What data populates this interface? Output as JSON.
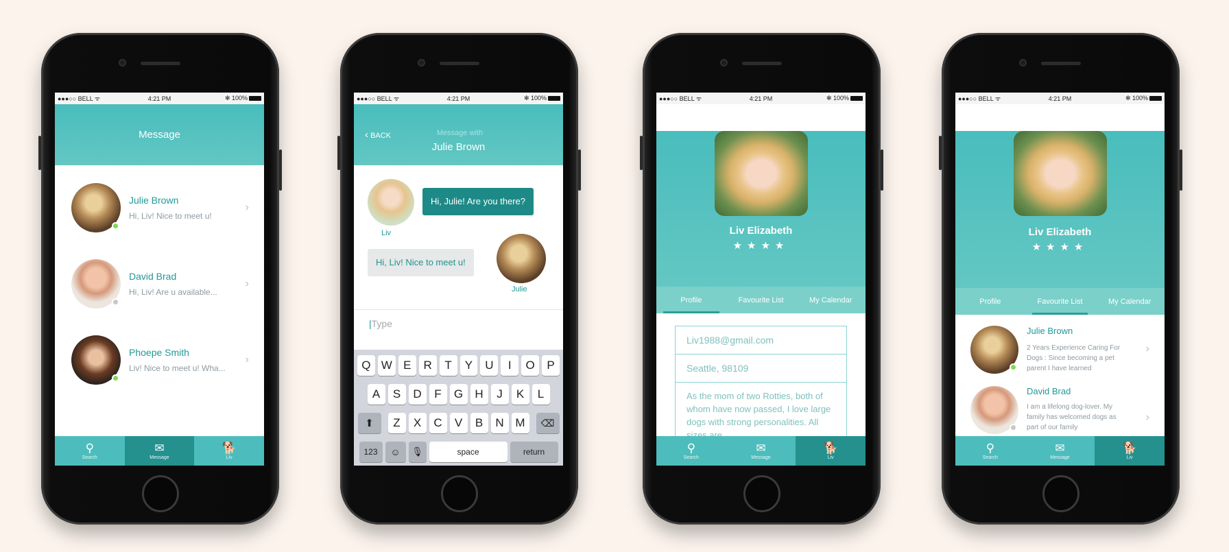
{
  "status": {
    "carrier": "●●●○○ BELL ᯤ",
    "time": "4:21 PM",
    "battery": "✻ 100%"
  },
  "tabs": [
    {
      "label": "Search",
      "icon": "search-icon"
    },
    {
      "label": "Message",
      "icon": "envelope-icon"
    },
    {
      "label": "Liv",
      "icon": "dog-icon"
    }
  ],
  "screen1": {
    "title": "Message",
    "conversations": [
      {
        "name": "Julie Brown",
        "preview": "Hi, Liv! Nice to meet u!",
        "status": "online"
      },
      {
        "name": "David Brad",
        "preview": "Hi, Liv! Are u available...",
        "status": "offline"
      },
      {
        "name": "Phoepe Smith",
        "preview": "Liv! Nice to meet u! Wha...",
        "status": "online"
      }
    ]
  },
  "screen2": {
    "back": "BACK",
    "subtitle": "Message with",
    "title": "Julie Brown",
    "messages": [
      {
        "from": "Liv",
        "text": "Hi, Julie! Are you there?"
      },
      {
        "from": "Julie",
        "text": "Hi, Liv! Nice to meet u!"
      }
    ],
    "input_placeholder": "Type",
    "keyboard": {
      "row1": [
        "Q",
        "W",
        "E",
        "R",
        "T",
        "Y",
        "U",
        "I",
        "O",
        "P"
      ],
      "row2": [
        "A",
        "S",
        "D",
        "F",
        "G",
        "H",
        "J",
        "K",
        "L"
      ],
      "row3": [
        "Z",
        "X",
        "C",
        "V",
        "B",
        "N",
        "M"
      ],
      "numbers": "123",
      "space": "space",
      "return": "return"
    }
  },
  "profile": {
    "name": "Liv Elizabeth",
    "rating": 4,
    "stars": "★★★★",
    "tabs": [
      "Profile",
      "Favourite List",
      "My Calendar"
    ],
    "email": "Liv1988@gmail.com",
    "location": "Seattle, 98109",
    "bio": "As the mom of two Rotties, both of whom have now passed, I love large dogs with strong personalities. All sizes are ..."
  },
  "favourites": [
    {
      "name": "Julie Brown",
      "desc": "2 Years Experience Caring For Dogs : Since becoming a pet parent I have learned",
      "status": "online"
    },
    {
      "name": "David Brad",
      "desc": "I am a lifelong dog-lover. My family has welcomed dogs as part of our family",
      "status": "offline"
    }
  ],
  "colors": {
    "accent": "#4cbdbc",
    "accent_dark": "#24918f",
    "text_teal": "#1f9a96",
    "online": "#7ed957",
    "offline": "#c8c8c8"
  }
}
